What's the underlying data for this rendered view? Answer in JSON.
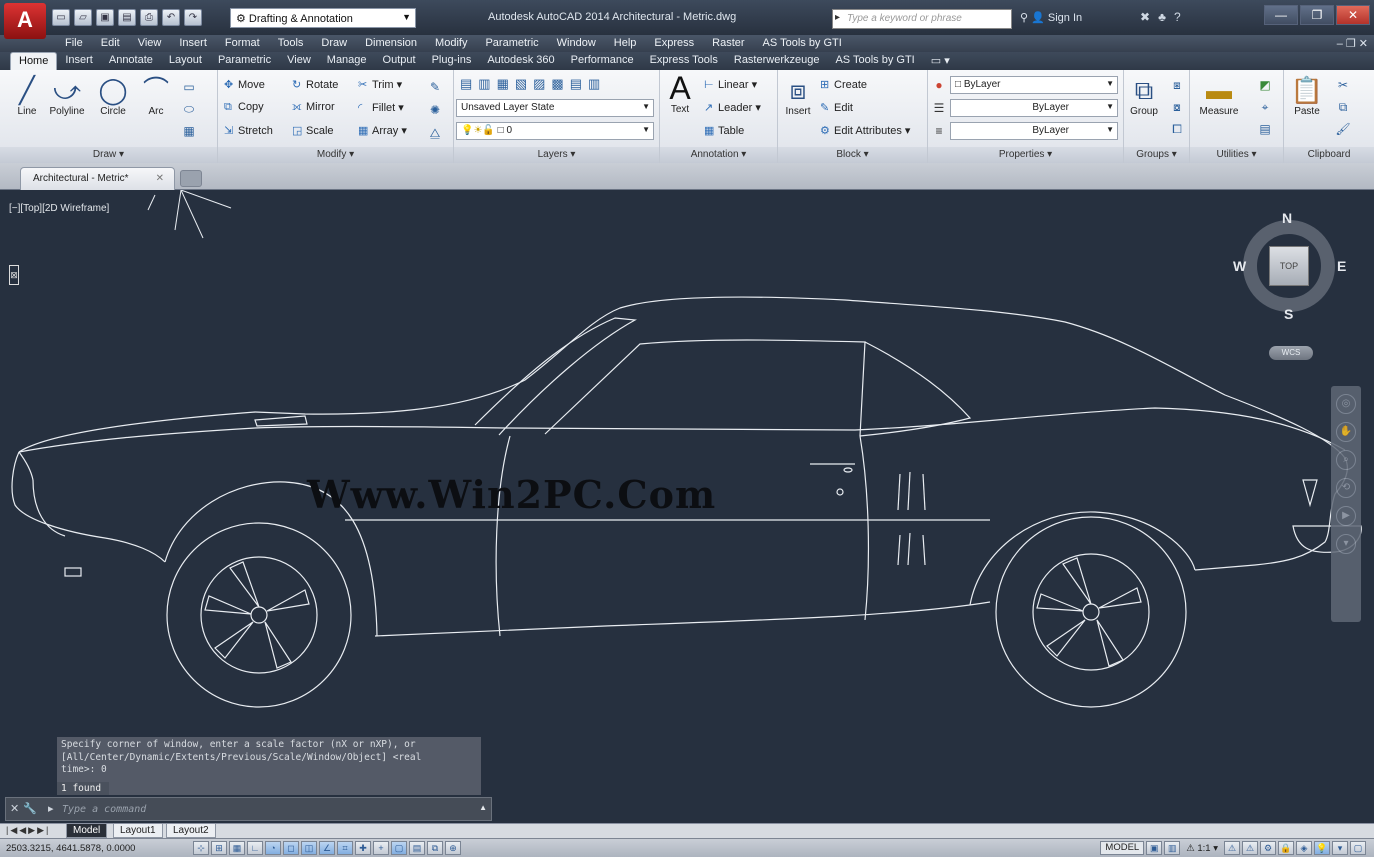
{
  "title_bar": {
    "logo_letter": "A",
    "workspace": "Drafting & Annotation",
    "app_title": "Autodesk AutoCAD 2014   Architectural - Metric.dwg",
    "search_placeholder": "Type a keyword or phrase",
    "sign_in": "Sign In",
    "window_buttons": [
      "—",
      "❐",
      "✕"
    ]
  },
  "menu_bar": [
    "File",
    "Edit",
    "View",
    "Insert",
    "Format",
    "Tools",
    "Draw",
    "Dimension",
    "Modify",
    "Parametric",
    "Window",
    "Help",
    "Express",
    "Raster",
    "AS Tools by GTI"
  ],
  "ribbon_tabs": [
    "Home",
    "Insert",
    "Annotate",
    "Layout",
    "Parametric",
    "View",
    "Manage",
    "Output",
    "Plug-ins",
    "Autodesk 360",
    "Performance",
    "Express Tools",
    "Rasterwerkzeuge",
    "AS Tools by GTI"
  ],
  "ribbon": {
    "draw": {
      "title": "Draw ▾",
      "line": "Line",
      "polyline": "Polyline",
      "circle": "Circle",
      "arc": "Arc"
    },
    "modify": {
      "title": "Modify ▾",
      "move": "Move",
      "rotate": "Rotate",
      "trim": "Trim",
      "copy": "Copy",
      "mirror": "Mirror",
      "fillet": "Fillet",
      "stretch": "Stretch",
      "scale": "Scale",
      "array": "Array"
    },
    "layers": {
      "title": "Layers ▾",
      "layer_state": "Unsaved Layer State",
      "current_layer": "0"
    },
    "annotation": {
      "title": "Annotation ▾",
      "text": "Text",
      "linear": "Linear",
      "leader": "Leader",
      "table": "Table"
    },
    "block": {
      "title": "Block ▾",
      "insert": "Insert",
      "create": "Create",
      "edit": "Edit",
      "edit_attributes": "Edit Attributes"
    },
    "properties": {
      "title": "Properties ▾",
      "color": "ByLayer",
      "linetype": "ByLayer",
      "lineweight": "ByLayer"
    },
    "groups": {
      "title": "Groups ▾",
      "group": "Group"
    },
    "utilities": {
      "title": "Utilities ▾",
      "measure": "Measure"
    },
    "clipboard": {
      "title": "Clipboard",
      "paste": "Paste"
    }
  },
  "file_tab": {
    "name": "Architectural - Metric*"
  },
  "viewport": {
    "label": "[−][Top][2D Wireframe]",
    "watermark": "Www.Win2PC.Com"
  },
  "viewcube": {
    "north": "N",
    "south": "S",
    "east": "E",
    "west": "W",
    "face": "TOP",
    "wcs": "WCS"
  },
  "command": {
    "history": [
      "Specify corner of window, enter a scale factor (nX or nXP), or",
      "[All/Center/Dynamic/Extents/Previous/Scale/Window/Object] <real",
      "time>: 0"
    ],
    "found": "1 found",
    "placeholder": "Type a command"
  },
  "layout_tabs": [
    "Model",
    "Layout1",
    "Layout2"
  ],
  "status_bar": {
    "coordinates": "2503.3215, 4641.5878, 0.0000",
    "model": "MODEL",
    "annotation_scale": "1:1"
  }
}
